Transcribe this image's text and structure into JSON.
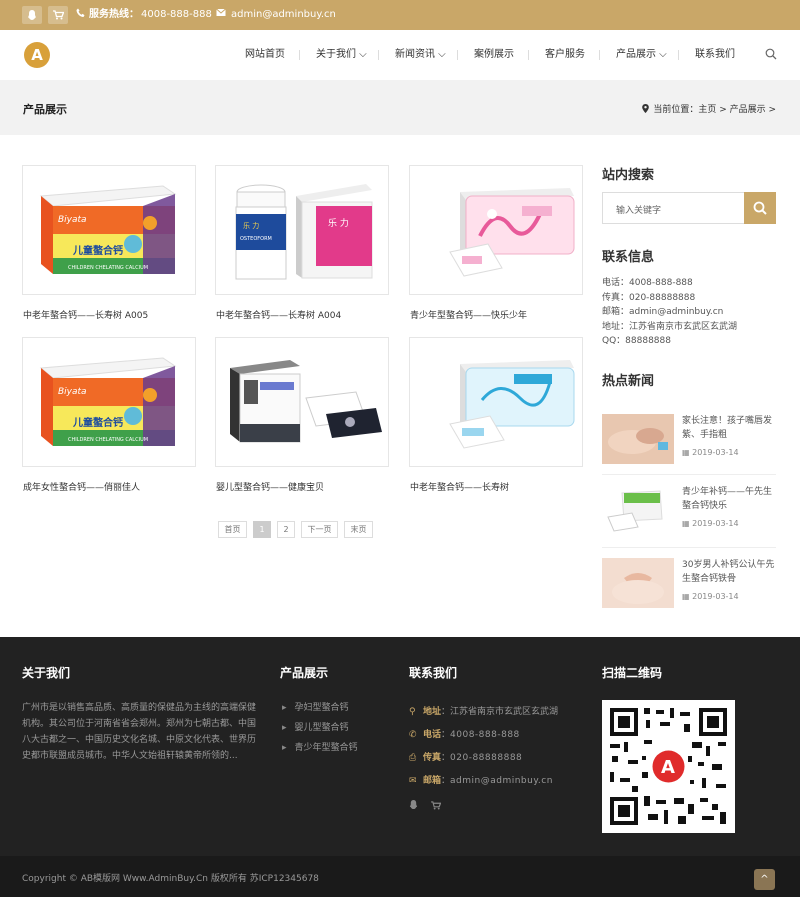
{
  "topbar": {
    "hotline_label": "服务热线：",
    "hotline": "4008-888-888",
    "email": "admin@adminbuy.cn",
    "qq_icon": "qq-icon",
    "cart_icon": "cart-icon",
    "phone_icon": "phone-icon",
    "mail_icon": "mail-icon"
  },
  "nav": {
    "logo_letter": "A",
    "items": [
      {
        "label": "网站首页"
      },
      {
        "label": "关于我们 ⌵"
      },
      {
        "label": "新闻资讯 ⌵"
      },
      {
        "label": "案例展示"
      },
      {
        "label": "客户服务"
      },
      {
        "label": "产品展示 ⌵"
      },
      {
        "label": "联系我们"
      }
    ]
  },
  "band": {
    "title": "产品展示",
    "crumb": "当前位置：主页 > 产品展示 >"
  },
  "products": [
    {
      "title": "中老年螯合钙——长寿树 A005"
    },
    {
      "title": "中老年螯合钙——长寿树 A004"
    },
    {
      "title": "青少年型螯合钙——快乐少年"
    },
    {
      "title": "成年女性螯合钙——俏丽佳人"
    },
    {
      "title": "婴儿型螯合钙——健康宝贝"
    },
    {
      "title": "中老年螯合钙——长寿树"
    }
  ],
  "pagination": {
    "first": "首页",
    "p1": "1",
    "p2": "2",
    "next": "下一页",
    "last": "末页"
  },
  "sidebar": {
    "search_title": "站内搜索",
    "search_placeholder": "输入关键字",
    "contact_title": "联系信息",
    "contact": [
      "电话：4008-888-888",
      "传真：020-88888888",
      "邮箱：admin@adminbuy.cn",
      "地址：江苏省南京市玄武区玄武湖",
      "QQ：88888888"
    ],
    "news_title": "热点新闻",
    "news": [
      {
        "title": "家长注意！孩子嘴唇发紫、手指粗",
        "date": "2019-03-14"
      },
      {
        "title": "青少年补钙——午先生螯合钙快乐",
        "date": "2019-03-14"
      },
      {
        "title": "30岁男人补钙公认午先生螯合钙铁骨",
        "date": "2019-03-14"
      }
    ]
  },
  "footer": {
    "about_title": "关于我们",
    "about_text": "广州市是以销售高品质、高质量的保健品为主线的高端保健机构。其公司位于河南省省会郑州。郑州为七朝古都、中国八大古都之一、中国历史文化名城、中原文化代表、世界历史都市联盟成员城市。中华人文始祖轩辕黄帝所领的...",
    "products_title": "产品展示",
    "cats": [
      "孕妇型螯合钙",
      "婴儿型螯合钙",
      "青少年型螯合钙"
    ],
    "contact_title": "联系我们",
    "addr_label": "地址",
    "addr": "江苏省南京市玄武区玄武湖",
    "tel_label": "电话",
    "tel": "4008-888-888",
    "fax_label": "传真",
    "fax": "020-88888888",
    "mail_label": "邮箱",
    "mail": "admin@adminbuy.cn",
    "qr_title": "扫描二维码",
    "copyright": "Copyright © AB模版网 Www.AdminBuy.Cn 版权所有   苏ICP12345678"
  }
}
